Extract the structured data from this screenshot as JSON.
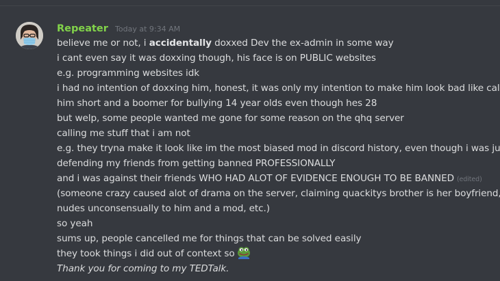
{
  "message": {
    "author": "Repeater",
    "timestamp": "Today at 9:34 AM",
    "lines": [
      {
        "before": "believe me or not, i ",
        "bold": "accidentally",
        "after": " doxxed Dev the ex-admin in some way"
      },
      {
        "text": "i cant even say it was doxxing though, his face is on PUBLIC websites"
      },
      {
        "text": "e.g. programming websites idk"
      },
      {
        "text": "i had no intention of doxxing him, honest, it was only my intention to make him look bad like calling"
      },
      {
        "text": "him short and a boomer for bullying 14 year olds even though hes 28"
      },
      {
        "text": "but welp, some people wanted me gone for some reason on the qhq server"
      },
      {
        "text": "calling me stuff that i am not"
      },
      {
        "text": "e.g. they tryna make it look like im the most biased mod in discord history, even though i was just"
      },
      {
        "text": "defending my friends from getting banned PROFESSIONALLY"
      },
      {
        "text": "and i was against their friends WHO HAD ALOT OF EVIDENCE ENOUGH TO BE BANNED",
        "edited": "(edited)"
      },
      {
        "text": "(someone crazy caused alot of drama on the server, claiming quackitys brother is her boyfriend, se"
      },
      {
        "text": "nudes unconsensually to him and a mod, etc.)"
      },
      {
        "text": "so yeah"
      },
      {
        "text": "sums up, people cancelled me for things that can be solved easily"
      },
      {
        "text": "they took things i did out of context so",
        "emoji": "pepe-frog-emoji"
      },
      {
        "italic": "Thank you for coming to my TEDTalk."
      }
    ]
  },
  "colors": {
    "background": "#36393f",
    "username": "#82d34a",
    "text": "#dcddde",
    "timestamp": "#72767d"
  }
}
